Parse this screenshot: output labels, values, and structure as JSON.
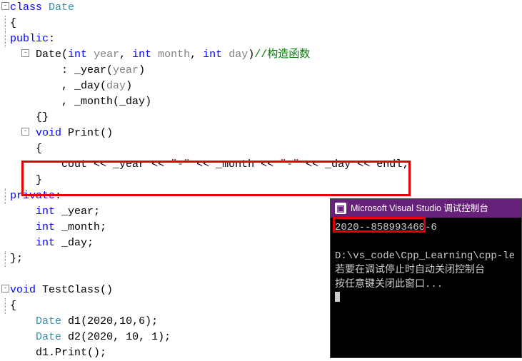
{
  "editor": {
    "class_kw": "class",
    "class_name": "Date",
    "brace_open": "{",
    "brace_close": "}",
    "brace_end": "};",
    "brace_fn_end": "{}",
    "public": "public",
    "private": "private",
    "ctor_name": "Date",
    "ctor_params_open": "(",
    "param_int": "int",
    "param_year": "year",
    "param_month": "month",
    "param_day": "day",
    "ctor_params_close": ")",
    "ctor_comment": "//构造函数",
    "init_year_lhs": "_year",
    "init_year_rhs": "year",
    "init_day_lhs": "_day",
    "init_day_rhs": "day",
    "init_month_lhs": "_month",
    "init_month_rhs": "_day",
    "colon_space": "        : ",
    "comma_space": "        , ",
    "void": "void",
    "print_name": "Print",
    "empty_parens": "()",
    "cout": "cout",
    "stream": " << ",
    "dash_str": "\"-\"",
    "y": "_year",
    "m": "_month",
    "d": "_day",
    "endl": "endl",
    "semicolon": ";",
    "int_t": "int",
    "test_fn": "TestClass",
    "date_type": "Date",
    "d1": "d1",
    "d1_args": "(2020,10,6)",
    "d2": "d2",
    "d2_args": "(2020, 10, 1)",
    "d1_print": "d1.Print()"
  },
  "console": {
    "title": "Microsoft Visual Studio 调试控制台",
    "output_line": "2020--858993460-6",
    "path_line": "D:\\vs_code\\Cpp_Learning\\cpp-le",
    "hint1": "若要在调试停止时自动关闭控制台",
    "hint2": "按任意键关闭此窗口..."
  }
}
